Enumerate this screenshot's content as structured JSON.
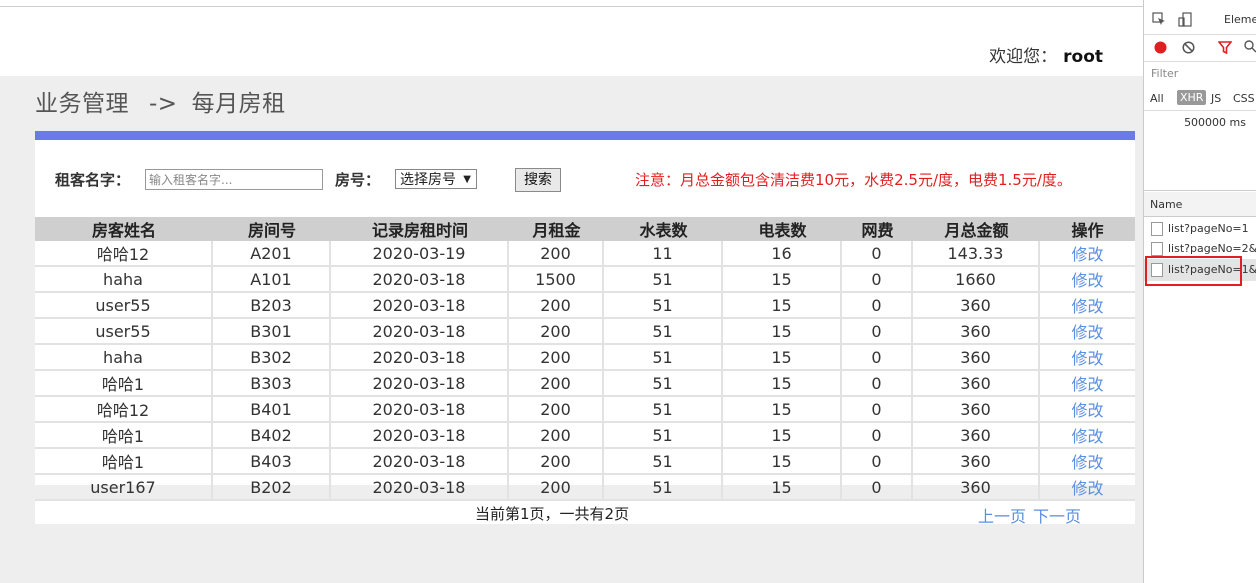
{
  "header": {
    "welcome_label": "欢迎您：",
    "username": "root"
  },
  "breadcrumb": {
    "section": "业务管理",
    "arrow": "->",
    "page": "每月房租"
  },
  "search": {
    "tenant_label": "租客名字：",
    "tenant_placeholder": "输入租客名字...",
    "room_label": "房号：",
    "room_select_value": "选择房号",
    "search_button": "搜索",
    "notice": "注意：月总金额包含清洁费10元，水费2.5元/度，电费1.5元/度。"
  },
  "table": {
    "columns": [
      "房客姓名",
      "房间号",
      "记录房租时间",
      "月租金",
      "水表数",
      "电表数",
      "网费",
      "月总金额",
      "操作"
    ],
    "rows": [
      [
        "哈哈12",
        "A201",
        "2020-03-19",
        "200",
        "11",
        "16",
        "0",
        "143.33",
        "修改"
      ],
      [
        "haha",
        "A101",
        "2020-03-18",
        "1500",
        "51",
        "15",
        "0",
        "1660",
        "修改"
      ],
      [
        "user55",
        "B203",
        "2020-03-18",
        "200",
        "51",
        "15",
        "0",
        "360",
        "修改"
      ],
      [
        "user55",
        "B301",
        "2020-03-18",
        "200",
        "51",
        "15",
        "0",
        "360",
        "修改"
      ],
      [
        "haha",
        "B302",
        "2020-03-18",
        "200",
        "51",
        "15",
        "0",
        "360",
        "修改"
      ],
      [
        "哈哈1",
        "B303",
        "2020-03-18",
        "200",
        "51",
        "15",
        "0",
        "360",
        "修改"
      ],
      [
        "哈哈12",
        "B401",
        "2020-03-18",
        "200",
        "51",
        "15",
        "0",
        "360",
        "修改"
      ],
      [
        "哈哈1",
        "B402",
        "2020-03-18",
        "200",
        "51",
        "15",
        "0",
        "360",
        "修改"
      ],
      [
        "哈哈1",
        "B403",
        "2020-03-18",
        "200",
        "51",
        "15",
        "0",
        "360",
        "修改"
      ],
      [
        "user167",
        "B202",
        "2020-03-18",
        "200",
        "51",
        "15",
        "0",
        "360",
        "修改"
      ]
    ]
  },
  "pager": {
    "info": "当前第1页，一共有2页",
    "prev": "上一页",
    "next": "下一页"
  },
  "devtools": {
    "tab_elements": "Eleme",
    "filter_placeholder": "Filter",
    "types": {
      "all": "All",
      "xhr": "XHR",
      "js": "JS",
      "css": "CSS"
    },
    "timeline_time": "500000 ms",
    "name_header": "Name",
    "requests": [
      "list?pageNo=1",
      "list?pageNo=2&",
      "list?pageNo=1&"
    ],
    "colors": {
      "record": "#e02020",
      "filter": "#e02020",
      "highlight": "#e02020"
    }
  },
  "colors": {
    "accent_bar": "#6a7ae6",
    "link": "#5b8fe0",
    "notice": "#e02020",
    "header_row": "#cfcfcf"
  }
}
